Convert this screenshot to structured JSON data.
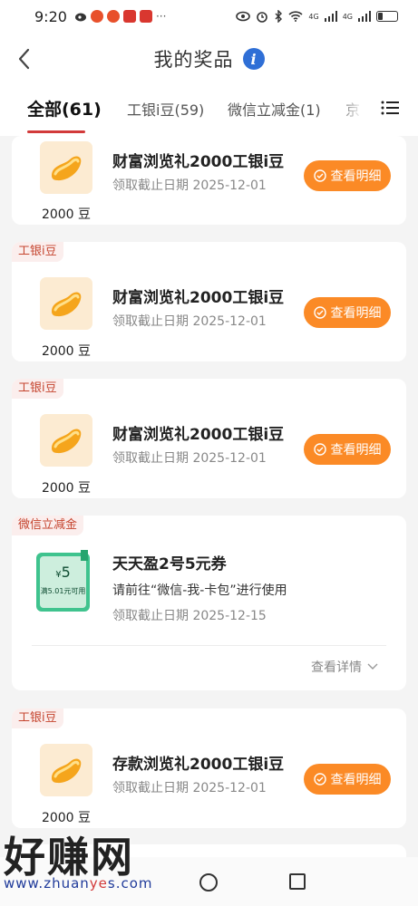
{
  "status_bar": {
    "time": "9:20",
    "icons": [
      "weibo-icon",
      "weibo-icon",
      "app-icon",
      "app-icon",
      "more-dots-icon",
      "eye-icon",
      "alarm-icon",
      "bluetooth-icon",
      "wifi-icon",
      "signal-icon",
      "signal-icon",
      "battery-icon"
    ],
    "notif_more": "···",
    "net1": "4G",
    "net2": "4G"
  },
  "header": {
    "title": "我的奖品",
    "info_icon": "i"
  },
  "tabs": [
    {
      "label": "全部(61)",
      "active": true
    },
    {
      "label": "工银i豆(59)",
      "active": false
    },
    {
      "label": "微信立减金(1)",
      "active": false
    },
    {
      "label": "京",
      "active": false
    }
  ],
  "cards": [
    {
      "tag": "",
      "amount": "2000 豆",
      "name": "财富浏览礼2000工银i豆",
      "deadline": "领取截止日期 2025-12-01",
      "button": "查看明细"
    },
    {
      "tag": "工银i豆",
      "amount": "2000 豆",
      "name": "财富浏览礼2000工银i豆",
      "deadline": "领取截止日期 2025-12-01",
      "button": "查看明细"
    },
    {
      "tag": "工银i豆",
      "amount": "2000 豆",
      "name": "财富浏览礼2000工银i豆",
      "deadline": "领取截止日期 2025-12-01",
      "button": "查看明细"
    },
    {
      "tag": "工银i豆",
      "amount": "2000 豆",
      "name": "存款浏览礼2000工银i豆",
      "deadline": "领取截止日期 2025-12-01",
      "button": "查看明细"
    }
  ],
  "coupon_card": {
    "tag": "微信立减金",
    "coupon_symbol": "¥",
    "coupon_value": "5",
    "coupon_condition": "满5.01元可用",
    "name": "天天盈2号5元券",
    "usage": "请前往“微信-我-卡包”进行使用",
    "deadline": "领取截止日期 2025-12-15",
    "more_link": "查看详情"
  },
  "watermark": {
    "brand": "好赚网",
    "url_prefix": "www.zhuan",
    "url_highlight": "ye",
    "url_suffix": "s.com"
  },
  "colors": {
    "accent_orange": "#fb8a26",
    "tab_underline": "#d23a3a",
    "tag_text": "#c5442e",
    "tag_bg": "#fbeeed",
    "coupon_green": "#3fc38e",
    "info_blue": "#2f6fd6"
  }
}
